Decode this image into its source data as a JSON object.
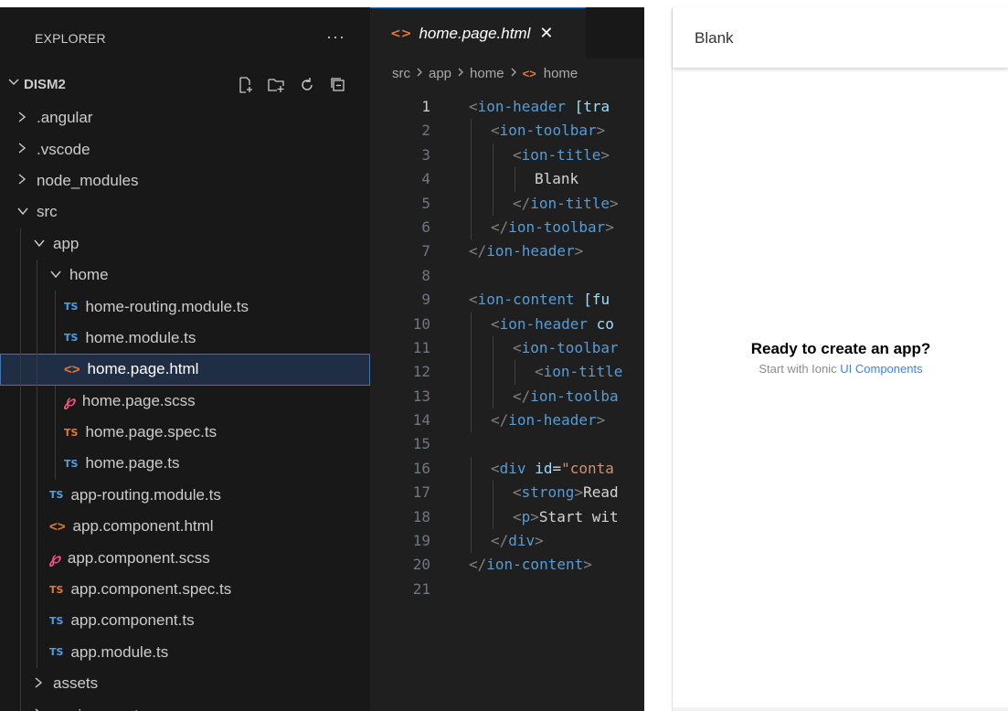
{
  "explorer": {
    "title": "EXPLORER",
    "more": "···",
    "project": "DISM2",
    "actions": [
      "new-file-icon",
      "new-folder-icon",
      "refresh-icon",
      "collapse-all-icon"
    ],
    "items": [
      {
        "label": ".angular",
        "type": "folder",
        "depth": 0,
        "open": false
      },
      {
        "label": ".vscode",
        "type": "folder",
        "depth": 0,
        "open": false
      },
      {
        "label": "node_modules",
        "type": "folder",
        "depth": 0,
        "open": false
      },
      {
        "label": "src",
        "type": "folder",
        "depth": 0,
        "open": true
      },
      {
        "label": "app",
        "type": "folder",
        "depth": 1,
        "open": true
      },
      {
        "label": "home",
        "type": "folder",
        "depth": 2,
        "open": true
      },
      {
        "label": "home-routing.module.ts",
        "type": "ts",
        "depth": 3
      },
      {
        "label": "home.module.ts",
        "type": "ts",
        "depth": 3
      },
      {
        "label": "home.page.html",
        "type": "html",
        "depth": 3,
        "selected": true
      },
      {
        "label": "home.page.scss",
        "type": "scss",
        "depth": 3
      },
      {
        "label": "home.page.spec.ts",
        "type": "spec",
        "depth": 3
      },
      {
        "label": "home.page.ts",
        "type": "ts",
        "depth": 3
      },
      {
        "label": "app-routing.module.ts",
        "type": "ts",
        "depth": 2
      },
      {
        "label": "app.component.html",
        "type": "html",
        "depth": 2
      },
      {
        "label": "app.component.scss",
        "type": "scss",
        "depth": 2
      },
      {
        "label": "app.component.spec.ts",
        "type": "spec",
        "depth": 2
      },
      {
        "label": "app.component.ts",
        "type": "ts",
        "depth": 2
      },
      {
        "label": "app.module.ts",
        "type": "ts",
        "depth": 2
      },
      {
        "label": "assets",
        "type": "folder",
        "depth": 1,
        "open": false
      },
      {
        "label": "environments",
        "type": "folder",
        "depth": 1,
        "open": false
      }
    ],
    "ts_icon_text": "TS",
    "html_icon_text": "<>",
    "scss_icon_text": "℘"
  },
  "editor": {
    "tab_label": "home.page.html",
    "tab_close": "✕",
    "breadcrumb": [
      "src",
      "app",
      "home",
      "home"
    ],
    "active_line": 1,
    "lines": [
      {
        "n": "1",
        "indent": 0,
        "parts": [
          [
            "tg",
            "<"
          ],
          [
            "tn",
            "ion-header"
          ],
          [
            "tx",
            " "
          ],
          [
            "at",
            "[tra"
          ]
        ]
      },
      {
        "n": "2",
        "indent": 1,
        "parts": [
          [
            "tg",
            "<"
          ],
          [
            "tn",
            "ion-toolbar"
          ],
          [
            "tg",
            ">"
          ]
        ]
      },
      {
        "n": "3",
        "indent": 2,
        "parts": [
          [
            "tg",
            "<"
          ],
          [
            "tn",
            "ion-title"
          ],
          [
            "tg",
            ">"
          ]
        ]
      },
      {
        "n": "4",
        "indent": 3,
        "parts": [
          [
            "tx",
            "Blank"
          ]
        ]
      },
      {
        "n": "5",
        "indent": 2,
        "parts": [
          [
            "tg",
            "</"
          ],
          [
            "tn",
            "ion-title"
          ],
          [
            "tg",
            ">"
          ]
        ]
      },
      {
        "n": "6",
        "indent": 1,
        "parts": [
          [
            "tg",
            "</"
          ],
          [
            "tn",
            "ion-toolbar"
          ],
          [
            "tg",
            ">"
          ]
        ]
      },
      {
        "n": "7",
        "indent": 0,
        "parts": [
          [
            "tg",
            "</"
          ],
          [
            "tn",
            "ion-header"
          ],
          [
            "tg",
            ">"
          ]
        ]
      },
      {
        "n": "8",
        "indent": 0,
        "parts": []
      },
      {
        "n": "9",
        "indent": 0,
        "parts": [
          [
            "tg",
            "<"
          ],
          [
            "tn",
            "ion-content"
          ],
          [
            "tx",
            " "
          ],
          [
            "at",
            "[fu"
          ]
        ]
      },
      {
        "n": "10",
        "indent": 1,
        "parts": [
          [
            "tg",
            "<"
          ],
          [
            "tn",
            "ion-header"
          ],
          [
            "tx",
            " "
          ],
          [
            "at",
            "co"
          ]
        ]
      },
      {
        "n": "11",
        "indent": 2,
        "parts": [
          [
            "tg",
            "<"
          ],
          [
            "tn",
            "ion-toolbar"
          ]
        ]
      },
      {
        "n": "12",
        "indent": 3,
        "parts": [
          [
            "tg",
            "<"
          ],
          [
            "tn",
            "ion-title"
          ]
        ]
      },
      {
        "n": "13",
        "indent": 2,
        "parts": [
          [
            "tg",
            "</"
          ],
          [
            "tn",
            "ion-toolba"
          ]
        ]
      },
      {
        "n": "14",
        "indent": 1,
        "parts": [
          [
            "tg",
            "</"
          ],
          [
            "tn",
            "ion-header"
          ],
          [
            "tg",
            ">"
          ]
        ]
      },
      {
        "n": "15",
        "indent": 0,
        "parts": []
      },
      {
        "n": "16",
        "indent": 1,
        "parts": [
          [
            "tg",
            "<"
          ],
          [
            "tn",
            "div"
          ],
          [
            "tx",
            " "
          ],
          [
            "at",
            "id"
          ],
          [
            "tx",
            "="
          ],
          [
            "st",
            "\"conta"
          ]
        ]
      },
      {
        "n": "17",
        "indent": 2,
        "parts": [
          [
            "tg",
            "<"
          ],
          [
            "tn",
            "strong"
          ],
          [
            "tg",
            ">"
          ],
          [
            "tx",
            "Read"
          ]
        ]
      },
      {
        "n": "18",
        "indent": 2,
        "parts": [
          [
            "tg",
            "<"
          ],
          [
            "tn",
            "p"
          ],
          [
            "tg",
            ">"
          ],
          [
            "tx",
            "Start wit"
          ]
        ]
      },
      {
        "n": "19",
        "indent": 1,
        "parts": [
          [
            "tg",
            "</"
          ],
          [
            "tn",
            "div"
          ],
          [
            "tg",
            ">"
          ]
        ]
      },
      {
        "n": "20",
        "indent": 0,
        "parts": [
          [
            "tg",
            "</"
          ],
          [
            "tn",
            "ion-content"
          ],
          [
            "tg",
            ">"
          ]
        ]
      },
      {
        "n": "21",
        "indent": 0,
        "parts": []
      }
    ]
  },
  "preview": {
    "toolbar_title": "Blank",
    "heading": "Ready to create an app?",
    "sub_prefix": "Start with Ionic ",
    "sub_link": "UI Components"
  },
  "colors": {
    "explorer_bg": "#181818",
    "editor_bg": "#1f1f1f",
    "selection_border": "#2b79d6",
    "ts_icon": "#4d9fe6",
    "spec_icon": "#e37933",
    "html_icon": "#e37933",
    "scss_icon": "#f55385",
    "ionic_link": "#3880ff"
  }
}
